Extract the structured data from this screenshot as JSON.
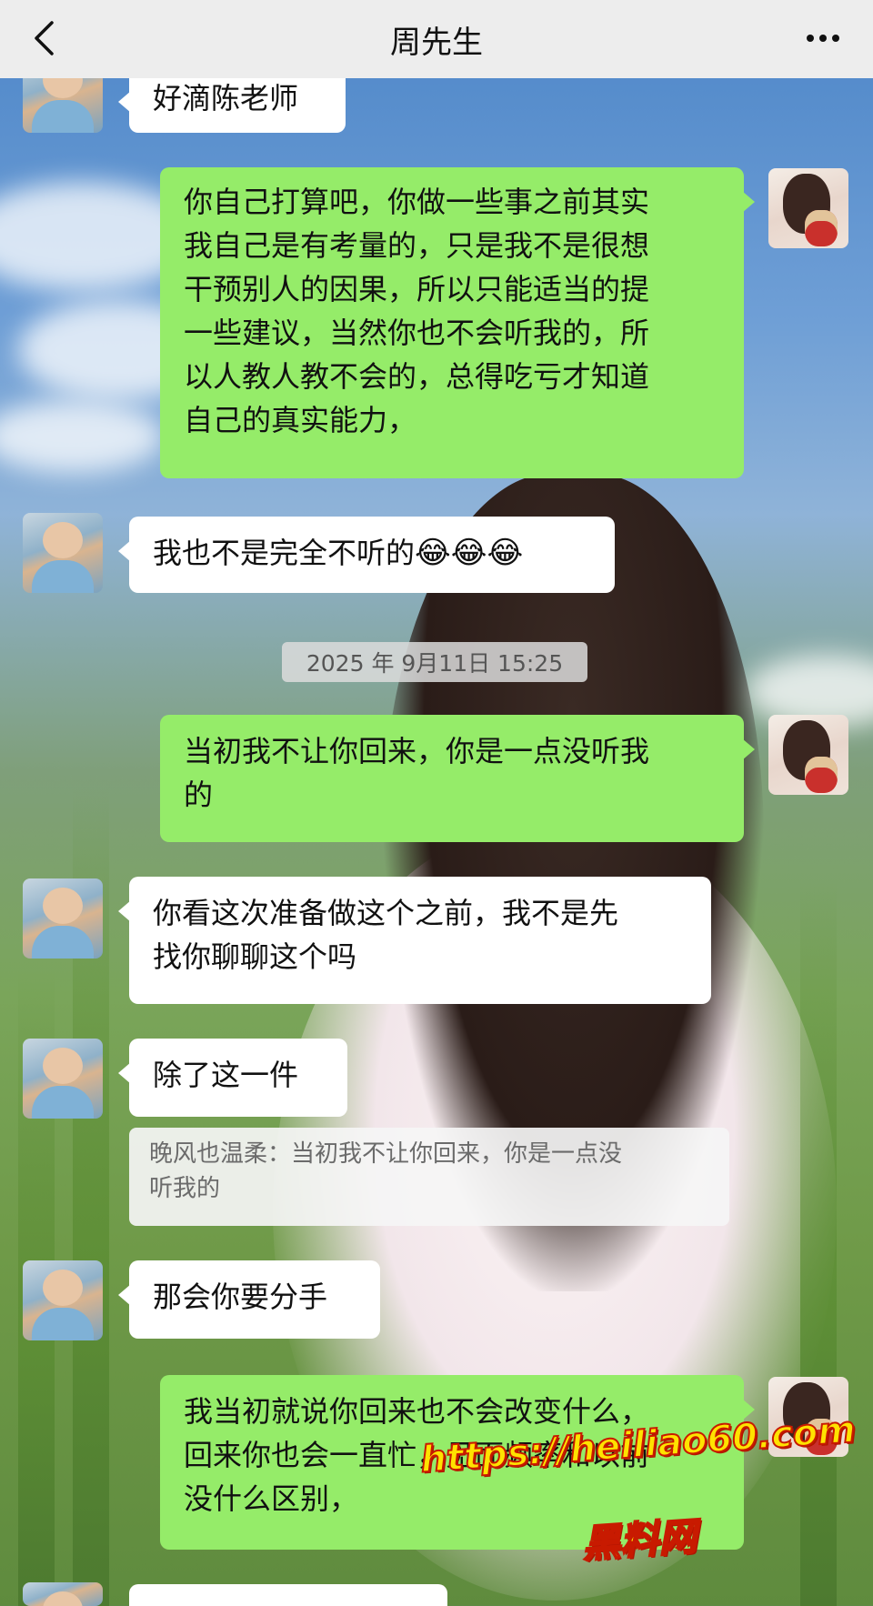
{
  "header": {
    "title": "周先生"
  },
  "timestamp": "2025 年 9月11日 15:25",
  "messages": [
    {
      "side": "left",
      "text": "好滴陈老师"
    },
    {
      "side": "right",
      "lines": [
        "你自己打算吧，你做一些事之前其实",
        "我自己是有考量的，只是我不是很想",
        "干预别人的因果，所以只能适当的提",
        "一些建议，当然你也不会听我的，所",
        "以人教人教不会的，总得吃亏才知道",
        "自己的真实能力，"
      ]
    },
    {
      "side": "left",
      "text": "我也不是完全不听的",
      "emoji": "😂😂😂"
    },
    {
      "side": "right",
      "lines": [
        "当初我不让你回来，你是一点没听我",
        "的"
      ]
    },
    {
      "side": "left",
      "lines": [
        "你看这次准备做这个之前，我不是先",
        "找你聊聊这个吗"
      ]
    },
    {
      "side": "left",
      "text": "除了这一件"
    },
    {
      "quote_lines": [
        "晚风也温柔：当初我不让你回来，你是一点没",
        "听我的"
      ]
    },
    {
      "side": "left",
      "text": "那会你要分手"
    },
    {
      "side": "right",
      "lines": [
        "我当初就说你回来也不会改变什么，",
        "回来你也会一直忙，见面频率和以前",
        "没什么区别，"
      ]
    }
  ],
  "watermark": {
    "url": "https://heiliao60.com",
    "name": "黑料网"
  },
  "colors": {
    "header_bg": "#ededed",
    "bubble_self": "#95ec69",
    "bubble_other": "#ffffff",
    "watermark_fill": "#ffe200",
    "watermark_stroke": "#c81a00"
  },
  "icons": [
    "chevron-left-icon",
    "more-dots-icon"
  ]
}
